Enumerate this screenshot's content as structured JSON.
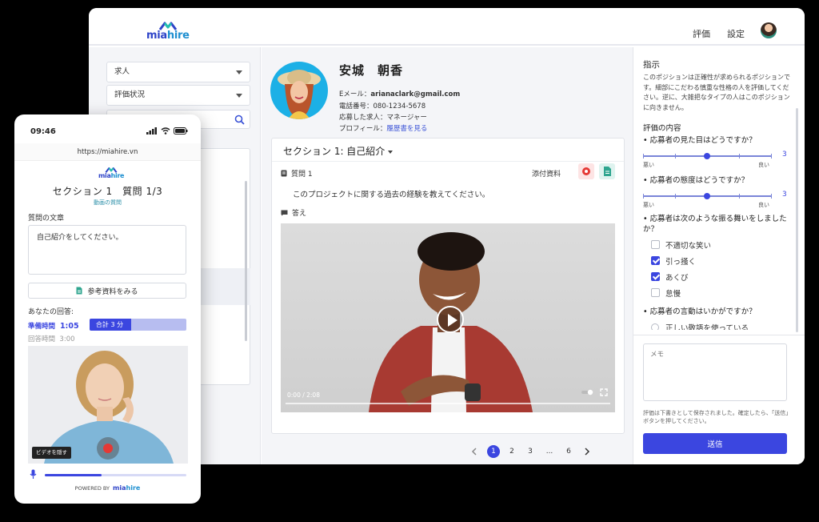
{
  "desktop": {
    "nav": {
      "evaluate": "評価",
      "settings": "設定"
    },
    "filters": {
      "job": "求人",
      "status": "評価状況"
    },
    "candidate": {
      "name": "安城　朝香",
      "email_label": "Eメール：",
      "email": "arianaclark@gmail.com",
      "phone": "電話番号：080-1234-5678",
      "job": "応募した求人：マネージャー",
      "profile_label": "プロフィール：",
      "profile_link": "履歴書を見る"
    },
    "section": {
      "title": "セクション 1: 自己紹介",
      "question_label": "質問 1",
      "attachments_label": "添付資料",
      "question_text": "このプロジェクトに関する過去の経験を教えてください。",
      "answer_label": "答え",
      "video_time": "0:00  /  2:08",
      "video_progress": 0.0
    },
    "pagination": [
      "1",
      "2",
      "3",
      "...",
      "6"
    ],
    "pagination_active": "1",
    "right": {
      "instructions_title": "指示",
      "instructions": "このポジションは正確性が求められるポジションです。細部にこだわる慎重な性格の人を評価してください。逆に、大雑把なタイプの人はこのポジションに向きません。",
      "eval_title": "評価の内容",
      "q1": "• 応募者の見た目はどうですか？",
      "q1_value": 3,
      "q2": "• 応募者の態度はどうですか？",
      "q2_value": 3,
      "scale_max": 5,
      "low": "悪い",
      "high": "良い",
      "q3": "• 応募者は次のような振る舞いをしましたか？",
      "options": [
        {
          "label": "不適切な笑い",
          "checked": false
        },
        {
          "label": "引っ掻く",
          "checked": true
        },
        {
          "label": "あくび",
          "checked": true
        },
        {
          "label": "怠慢",
          "checked": false
        }
      ],
      "q4": "• 応募者の言動はいかがですか？",
      "q4_option": "正しい敬語を使っている",
      "memo_placeholder": "メモ",
      "save_note": "評価は下書きとして保存されました。確定したら、「送信」ボタンを押してください。",
      "send": "送信"
    }
  },
  "phone": {
    "time": "09:46",
    "url": "https://miahire.vn",
    "title": "セクション 1　質問 1/3",
    "badge": "動画の質問",
    "question_label": "質問の文章",
    "question_text": "自己紹介をしてください。",
    "ref_button": "参考資料をみる",
    "answer_label": "あなたの回答:",
    "prep_label": "準備時間",
    "prep_time": "1:05",
    "total_label": "合計 3 分",
    "total_fill": 0.43,
    "answer_time_label": "回答時間",
    "answer_time": "3:00",
    "hide_video": "ビデオを隠す",
    "mic_level": 0.4,
    "powered_by": "POWERED BY"
  },
  "brand": {
    "mia": "mia",
    "hire": "hire"
  },
  "colors": {
    "accent": "#3b46e0",
    "brand_dark": "#2e44c8",
    "brand_light": "#1e8fd0"
  }
}
